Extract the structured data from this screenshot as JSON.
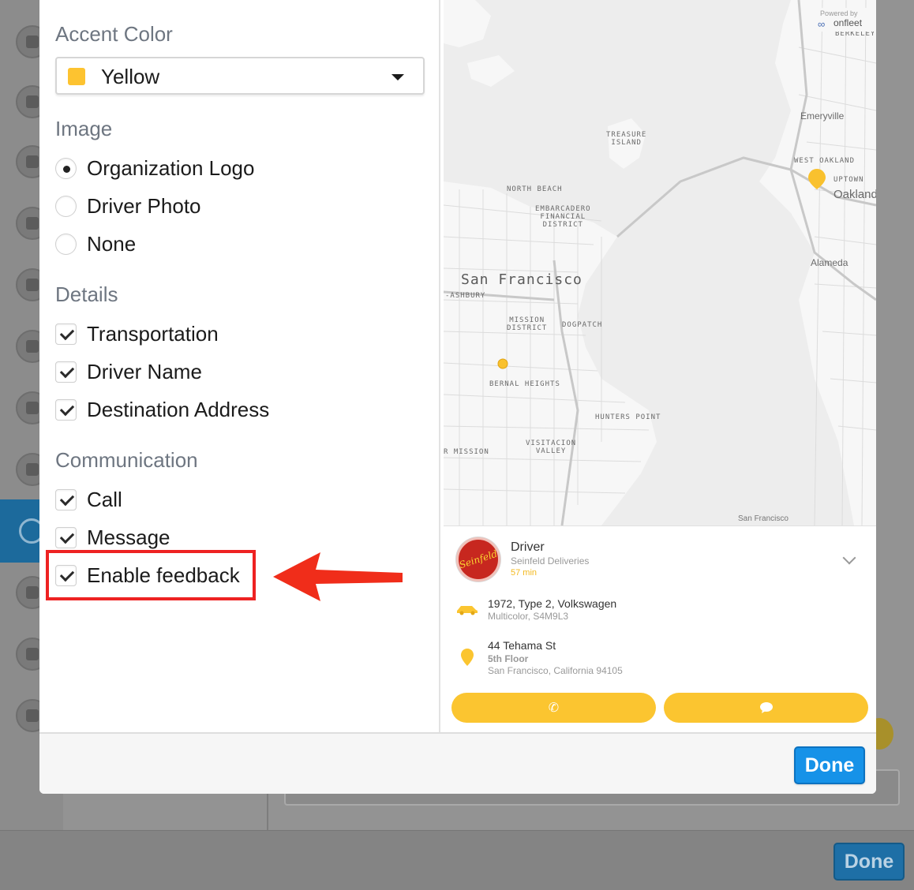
{
  "left_panel": {
    "accent_title": "Accent Color",
    "accent_value": "Yellow",
    "accent_color": "#fdc330",
    "image_title": "Image",
    "image_options": [
      {
        "label": "Organization Logo",
        "selected": true
      },
      {
        "label": "Driver Photo",
        "selected": false
      },
      {
        "label": "None",
        "selected": false
      }
    ],
    "details_title": "Details",
    "details_options": [
      {
        "label": "Transportation",
        "checked": true
      },
      {
        "label": "Driver Name",
        "checked": true
      },
      {
        "label": "Destination Address",
        "checked": true
      }
    ],
    "communication_title": "Communication",
    "communication_options": [
      {
        "label": "Call",
        "checked": true
      },
      {
        "label": "Message",
        "checked": true
      },
      {
        "label": "Enable feedback",
        "checked": true
      }
    ]
  },
  "annotation": {
    "highlight_color": "#ee2222",
    "arrow_color": "#f02d1a"
  },
  "map": {
    "powered_by": "Powered by",
    "brand": "onfleet",
    "city": "San Francisco",
    "corner_label": "San Francisco",
    "labels": [
      "TREASURE\nISLAND",
      "NORTH BEACH",
      "EMBARCADERO\nFINANCIAL\nDISTRICT",
      "-ASHBURY",
      "MISSION\nDISTRICT",
      "DOGPATCH",
      "BERNAL HEIGHTS",
      "HUNTERS POINT",
      "VISITACION\nVALLEY",
      "R MISSION",
      "WEST OAKLAND",
      "UPTOWN",
      "BERKELEY"
    ],
    "towns": [
      "Emeryville",
      "Oakland",
      "Alameda"
    ]
  },
  "driver_card": {
    "logo_text": "Seinfeld",
    "title": "Driver",
    "organization": "Seinfeld Deliveries",
    "eta": "57 min",
    "vehicle": "1972, Type 2, Volkswagen",
    "vehicle_details": "Multicolor, S4M9L3",
    "address": "44 Tehama St",
    "unit": "5th Floor",
    "city_line": "San Francisco, California 94105",
    "call_icon": "phone-icon",
    "message_icon": "chat-bubble-icon",
    "button_color": "#fbc530"
  },
  "footer": {
    "done_label": "Done"
  },
  "background": {
    "done_label": "Done"
  }
}
